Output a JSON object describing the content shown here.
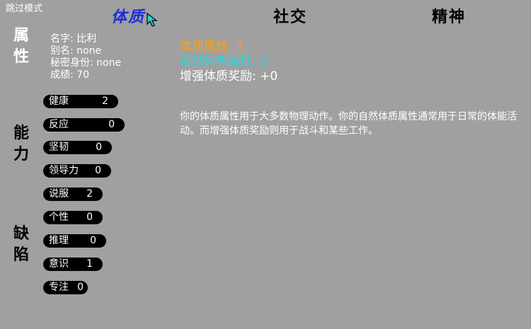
{
  "skip_mode": "跳过模式",
  "tabs": [
    {
      "label": "体质",
      "active": true
    },
    {
      "label": "社交",
      "active": false
    },
    {
      "label": "精神",
      "active": false
    }
  ],
  "side_labels": {
    "attributes": [
      "属",
      "性"
    ],
    "abilities": [
      "能",
      "力"
    ],
    "flaws": [
      "缺",
      "陷"
    ]
  },
  "character": {
    "name": "名字: 比利",
    "alias": "别名: none",
    "secret_identity": "秘密身份: none",
    "achievement": "成绩: 70"
  },
  "skills": [
    {
      "name": "健康",
      "value": "2"
    },
    {
      "name": "反应",
      "value": "0"
    },
    {
      "name": "坚韧",
      "value": "0"
    },
    {
      "name": "领导力",
      "value": "0"
    },
    {
      "name": "说服",
      "value": "2"
    },
    {
      "name": "个性",
      "value": "0"
    },
    {
      "name": "推理",
      "value": "0"
    },
    {
      "name": "意识",
      "value": "1"
    },
    {
      "name": "专注",
      "value": "0"
    }
  ],
  "stats": {
    "physical_attr": "体质属性: 3",
    "natural_physical_attr": "自然体质属性: 3",
    "physical_bonus": "增强体质奖励: +0"
  },
  "description": "你的体质属性用于大多数物理动作。你的自然体质属性通常用于日常的体能活动。而增强体质奖励则用于战斗和某些工作。",
  "colors": {
    "background": "#a0a0a0",
    "active_tab": "#1a2fd6",
    "stat_orange": "#f5a21a",
    "stat_cyan": "#2bd4dc"
  }
}
